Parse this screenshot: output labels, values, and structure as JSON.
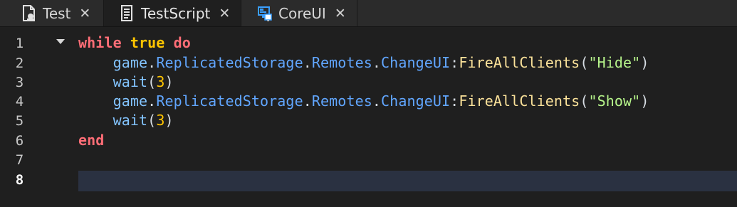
{
  "tabs": [
    {
      "label": "Test",
      "icon": "local-script-icon",
      "active": false
    },
    {
      "label": "TestScript",
      "icon": "script-icon",
      "active": true
    },
    {
      "label": "CoreUI",
      "icon": "screen-gui-icon",
      "active": false
    }
  ],
  "close_glyph": "✕",
  "gutter": {
    "lines": [
      "1",
      "2",
      "3",
      "4",
      "5",
      "6",
      "7",
      "8"
    ],
    "current_line": "8"
  },
  "code": {
    "l1": {
      "kw1": "while",
      "sp1": " ",
      "bool": "true",
      "sp2": " ",
      "kw2": "do"
    },
    "l2": {
      "indent": "    ",
      "game": "game",
      "d1": ".",
      "rs": "ReplicatedStorage",
      "d2": ".",
      "rem": "Remotes",
      "d3": ".",
      "cu": "ChangeUI",
      "colon": ":",
      "fn": "FireAllClients",
      "op": "(",
      "str": "\"Hide\"",
      "cp": ")"
    },
    "l3": {
      "indent": "    ",
      "fn": "wait",
      "op": "(",
      "num": "3",
      "cp": ")"
    },
    "l4": {
      "indent": "    ",
      "game": "game",
      "d1": ".",
      "rs": "ReplicatedStorage",
      "d2": ".",
      "rem": "Remotes",
      "d3": ".",
      "cu": "ChangeUI",
      "colon": ":",
      "fn": "FireAllClients",
      "op": "(",
      "str": "\"Show\"",
      "cp": ")"
    },
    "l5": {
      "indent": "    ",
      "fn": "wait",
      "op": "(",
      "num": "3",
      "cp": ")"
    },
    "l6": {
      "kw": "end"
    }
  },
  "colors": {
    "keyword": "#ff6d76",
    "boolean": "#ffc400",
    "global": "#83c4ff",
    "property": "#61a6ff",
    "method": "#fbe29a",
    "string": "#b7f58b",
    "number": "#ffc400",
    "current_line": "#2a3141"
  }
}
